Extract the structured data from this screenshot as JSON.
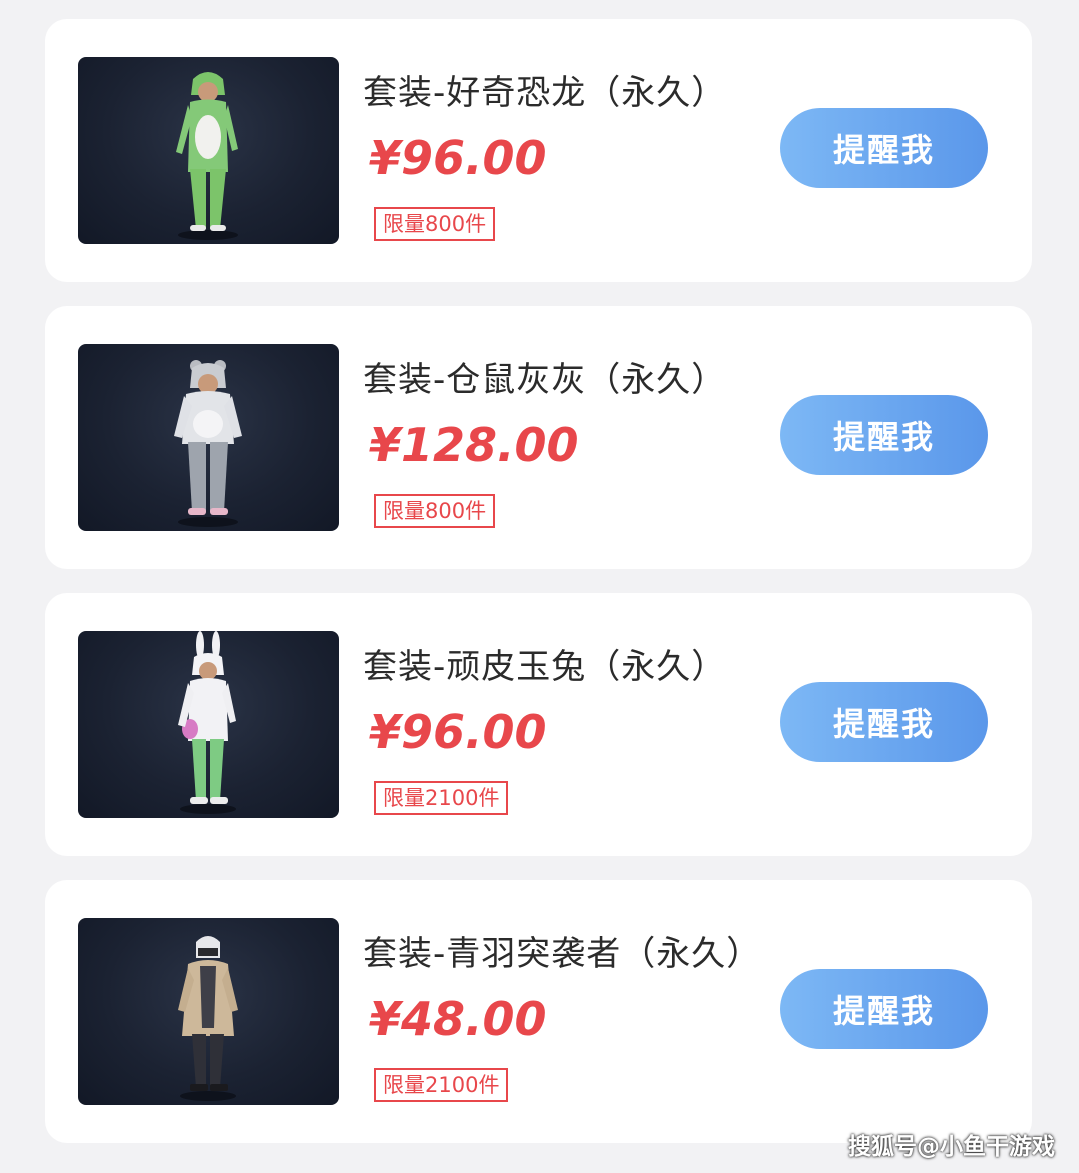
{
  "items": [
    {
      "title": "套装-好奇恐龙（永久）",
      "price": "¥96.00",
      "limit": "限量800件",
      "button": "提醒我",
      "image_icon": "green-dinosaur-costume"
    },
    {
      "title": "套装-仓鼠灰灰（永久）",
      "price": "¥128.00",
      "limit": "限量800件",
      "button": "提醒我",
      "image_icon": "grey-hamster-costume"
    },
    {
      "title": "套装-顽皮玉兔（永久）",
      "price": "¥96.00",
      "limit": "限量2100件",
      "button": "提醒我",
      "image_icon": "white-rabbit-costume"
    },
    {
      "title": "套装-青羽突袭者（永久）",
      "price": "¥48.00",
      "limit": "限量2100件",
      "button": "提醒我",
      "image_icon": "feather-raider-outfit"
    }
  ],
  "watermark": "搜狐号@小鱼干游戏",
  "colors": {
    "price": "#e8474b",
    "button_start": "#7db8f5",
    "button_end": "#5a97ea",
    "card_bg": "#ffffff",
    "page_bg": "#f2f2f4"
  }
}
